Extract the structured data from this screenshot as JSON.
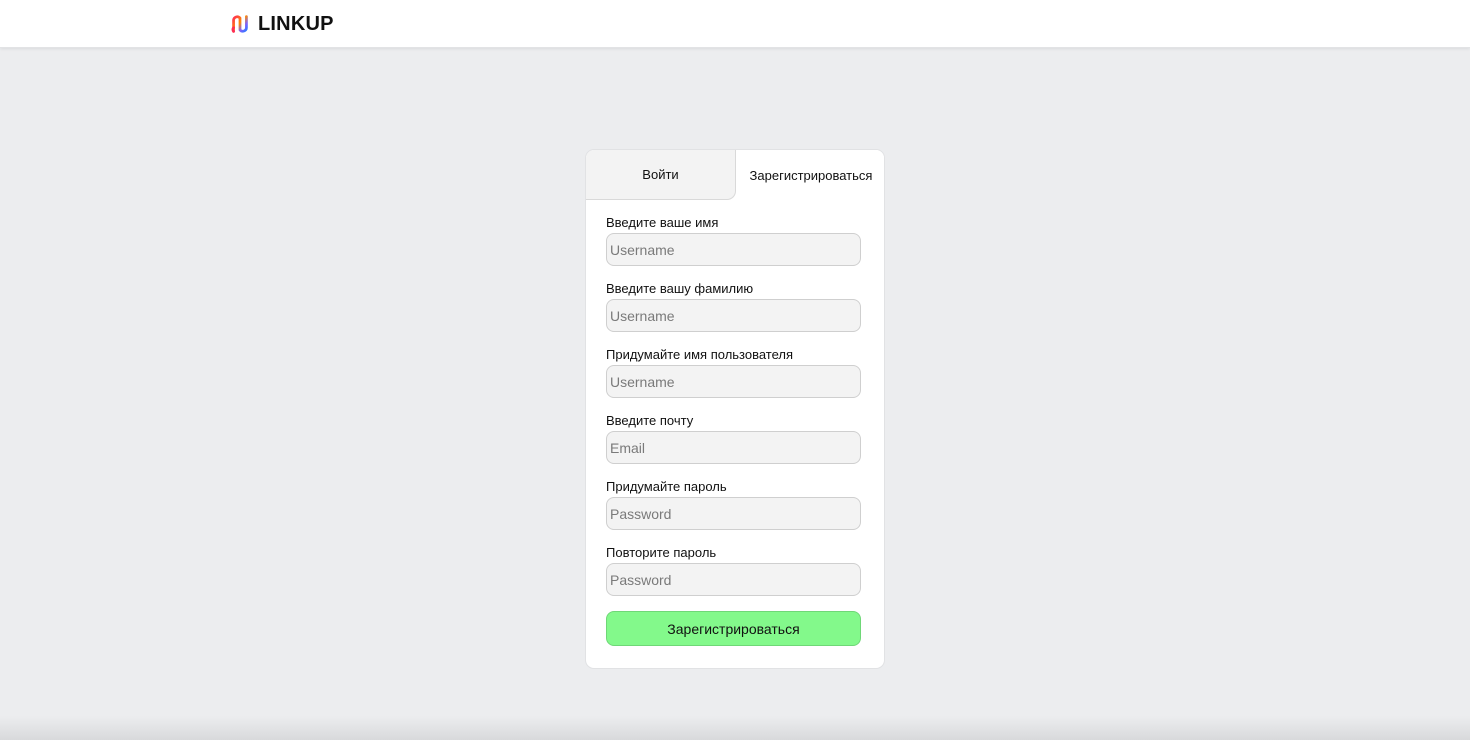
{
  "header": {
    "brand_name": "LINKUP",
    "logo_icon": "linkup-logo-icon"
  },
  "auth": {
    "tabs": {
      "login_label": "Войти",
      "register_label": "Зарегистрироваться"
    },
    "fields": [
      {
        "label": "Введите ваше имя",
        "placeholder": "Username",
        "value": ""
      },
      {
        "label": "Введите вашу фамилию",
        "placeholder": "Username",
        "value": ""
      },
      {
        "label": "Придумайте имя пользователя",
        "placeholder": "Username",
        "value": ""
      },
      {
        "label": "Введите почту",
        "placeholder": "Email",
        "value": ""
      },
      {
        "label": "Придумайте пароль",
        "placeholder": "Password",
        "value": ""
      },
      {
        "label": "Повторите пароль",
        "placeholder": "Password",
        "value": ""
      }
    ],
    "submit_label": "Зарегистрироваться"
  },
  "colors": {
    "page_background": "#ecedef",
    "card_background": "#ffffff",
    "input_background": "#f3f3f3",
    "submit_button": "#83f98b",
    "logo_gradient": [
      "#ff2d55",
      "#ff8a00",
      "#7b61ff",
      "#2b7bff"
    ]
  }
}
